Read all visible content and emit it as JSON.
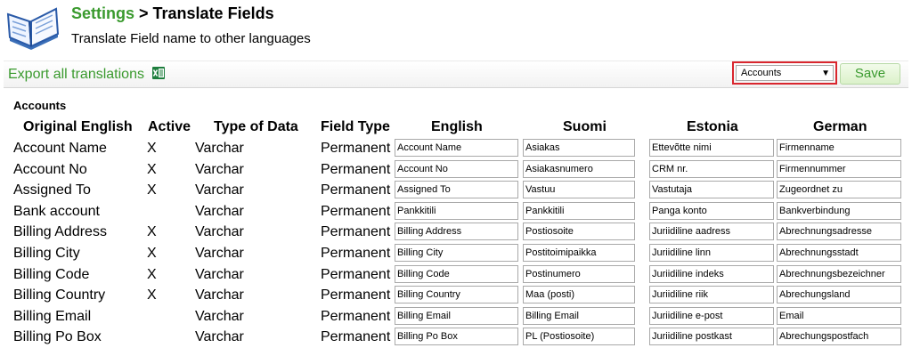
{
  "header": {
    "crumb": "Settings",
    "separator": " > ",
    "page_title": "Translate Fields",
    "subtitle": "Translate Field name to other languages"
  },
  "toolbar": {
    "export_label": "Export all translations",
    "module_select": "Accounts",
    "select_arrow": "▼",
    "save_label": "Save"
  },
  "section_label": "Accounts",
  "columns": [
    "Original English",
    "Active",
    "Type of Data",
    "Field Type",
    "English",
    "Suomi",
    "Estonia",
    "German"
  ],
  "rows": [
    {
      "original": "Account Name",
      "active": "X",
      "type": "Varchar",
      "field_type": "Permanent",
      "english": "Account Name",
      "suomi": "Asiakas",
      "estonia": "Ettevõtte nimi",
      "german": "Firmenname"
    },
    {
      "original": "Account No",
      "active": "X",
      "type": "Varchar",
      "field_type": "Permanent",
      "english": "Account No",
      "suomi": "Asiakasnumero",
      "estonia": "CRM nr.",
      "german": "Firmennummer"
    },
    {
      "original": "Assigned To",
      "active": "X",
      "type": "Varchar",
      "field_type": "Permanent",
      "english": "Assigned To",
      "suomi": "Vastuu",
      "estonia": "Vastutaja",
      "german": "Zugeordnet zu"
    },
    {
      "original": "Bank account",
      "active": "",
      "type": "Varchar",
      "field_type": "Permanent",
      "english": "Pankkitili",
      "suomi": "Pankkitili",
      "estonia": "Panga konto",
      "german": "Bankverbindung"
    },
    {
      "original": "Billing Address",
      "active": "X",
      "type": "Varchar",
      "field_type": "Permanent",
      "english": "Billing Address",
      "suomi": "Postiosoite",
      "estonia": "Juriidiline aadress",
      "german": "Abrechnungsadresse"
    },
    {
      "original": "Billing City",
      "active": "X",
      "type": "Varchar",
      "field_type": "Permanent",
      "english": "Billing City",
      "suomi": "Postitoimipaikka",
      "estonia": "Juriidiline linn",
      "german": "Abrechnungsstadt"
    },
    {
      "original": "Billing Code",
      "active": "X",
      "type": "Varchar",
      "field_type": "Permanent",
      "english": "Billing Code",
      "suomi": "Postinumero",
      "estonia": "Juriidiline indeks",
      "german": "Abrechnungsbezeichner"
    },
    {
      "original": "Billing Country",
      "active": "X",
      "type": "Varchar",
      "field_type": "Permanent",
      "english": "Billing Country",
      "suomi": "Maa (posti)",
      "estonia": "Juriidiline riik",
      "german": "Abrechungsland"
    },
    {
      "original": "Billing Email",
      "active": "",
      "type": "Varchar",
      "field_type": "Permanent",
      "english": "Billing Email",
      "suomi": "Billing Email",
      "estonia": "Juriidiline e-post",
      "german": "Email"
    },
    {
      "original": "Billing Po Box",
      "active": "",
      "type": "Varchar",
      "field_type": "Permanent",
      "english": "Billing Po Box",
      "suomi": "PL (Postiosoite)",
      "estonia": "Juriidiline postkast",
      "german": "Abrechungspostfach"
    }
  ],
  "colors": {
    "accent_green": "#3a9a2e",
    "highlight_red": "#d9262e"
  }
}
